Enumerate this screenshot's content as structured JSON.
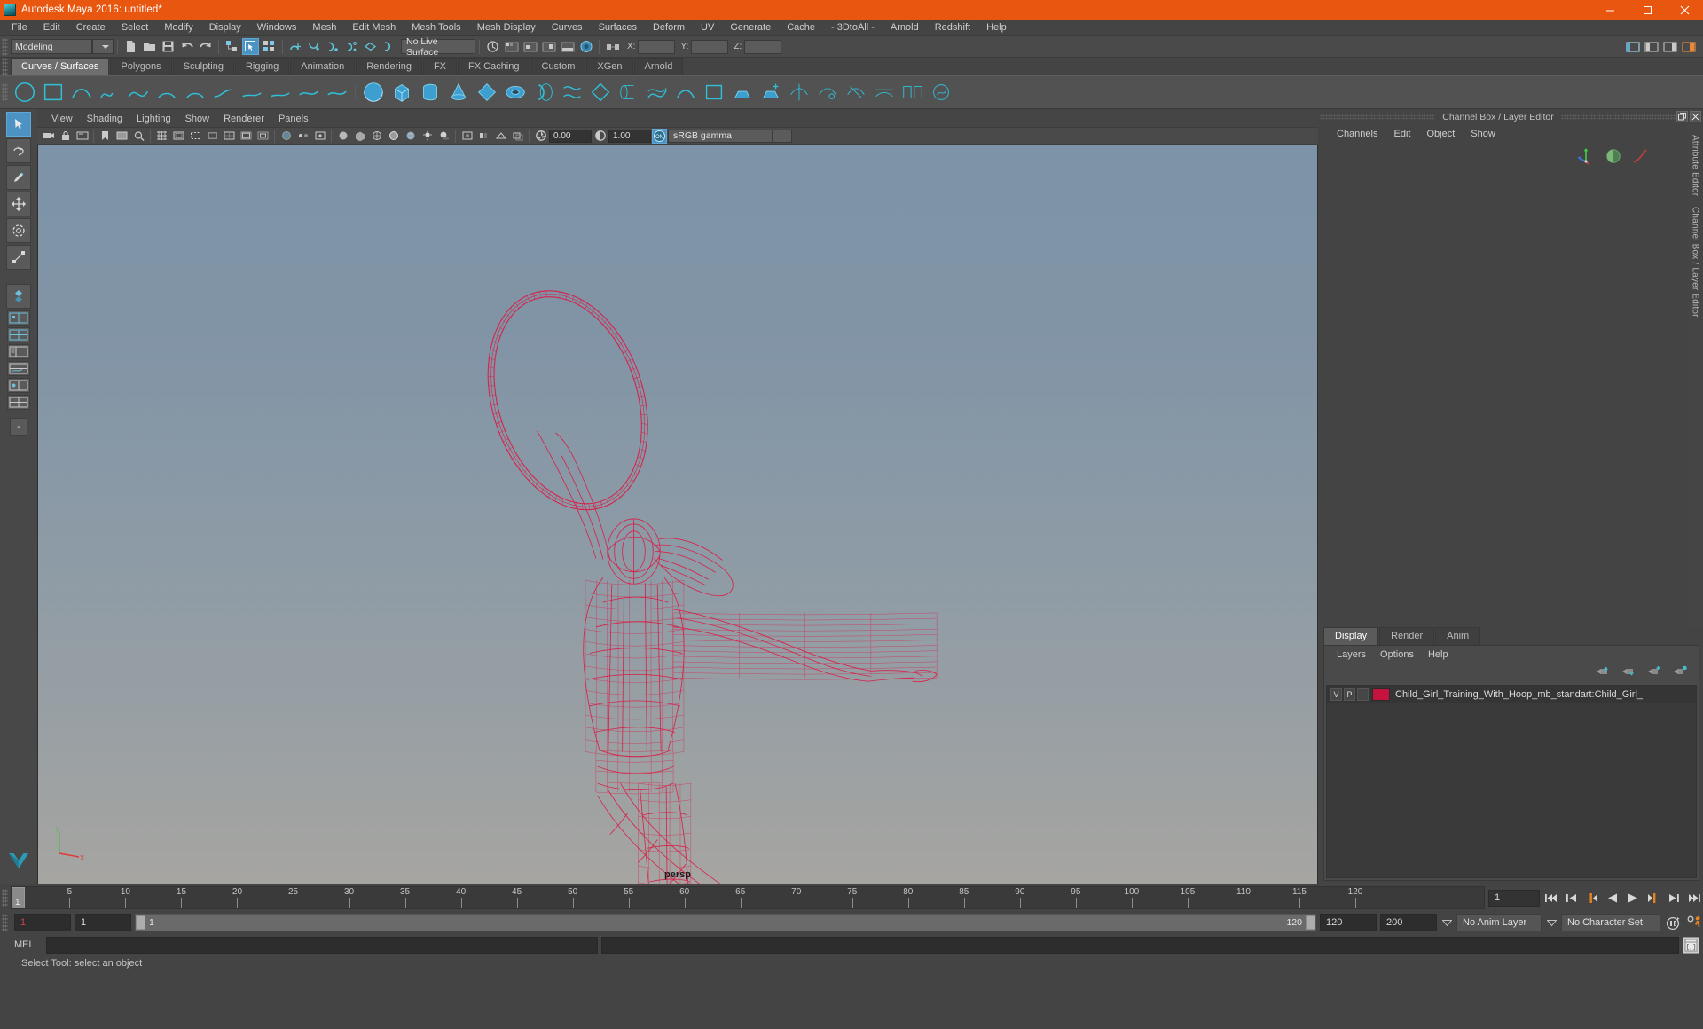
{
  "window": {
    "title": "Autodesk Maya 2016: untitled*",
    "logo_icon": "maya-logo-icon",
    "minimize_label": "–",
    "maximize_label": "❐",
    "close_label": "✕"
  },
  "menubar": {
    "items": [
      "File",
      "Edit",
      "Create",
      "Select",
      "Modify",
      "Display",
      "Windows",
      "Mesh",
      "Edit Mesh",
      "Mesh Tools",
      "Mesh Display",
      "Curves",
      "Surfaces",
      "Deform",
      "UV",
      "Generate",
      "Cache",
      "- 3DtoAll -",
      "Arnold",
      "Redshift",
      "Help"
    ]
  },
  "toolbar": {
    "menuset": "Modeling",
    "live_surface": "No Live Surface",
    "coord_labels": {
      "x": "X:",
      "y": "Y:",
      "z": "Z:"
    },
    "coord_values": {
      "x": "",
      "y": "",
      "z": ""
    },
    "icons": [
      "new-scene-icon",
      "open-scene-icon",
      "save-scene-icon",
      "undo-icon",
      "redo-icon",
      "select-hierarchy-icon",
      "select-object-icon",
      "select-component-icon",
      "snap-grid-icon",
      "snap-curve-icon",
      "snap-point-icon",
      "snap-projected-icon",
      "snap-view-plane-icon",
      "make-live-icon"
    ],
    "right_icons": [
      "show-hide-ui-icon",
      "attribute-editor-icon",
      "tool-settings-icon",
      "channel-box-icon"
    ]
  },
  "shelf": {
    "tabs": [
      "Curves / Surfaces",
      "Polygons",
      "Sculpting",
      "Rigging",
      "Animation",
      "Rendering",
      "FX",
      "FX Caching",
      "Custom",
      "XGen",
      "Arnold"
    ],
    "active_tab": "Curves / Surfaces",
    "icons": [
      "nurbs-circle-icon",
      "nurbs-square-icon",
      "ep-curve-icon",
      "pencil-curve-icon",
      "bezier-curve-icon",
      "three-point-arc-icon",
      "two-point-arc-icon",
      "curve-fillet-icon",
      "attach-curves-icon",
      "detach-curves-icon",
      "offset-curve-icon",
      "rebuild-curve-icon",
      "nurbs-sphere-icon",
      "nurbs-cube-icon",
      "nurbs-cylinder-icon",
      "nurbs-cone-icon",
      "nurbs-plane-icon",
      "nurbs-torus-icon",
      "revolve-icon",
      "loft-icon",
      "planar-icon",
      "extrude-icon",
      "birail-icon",
      "boundary-icon",
      "square-surface-icon",
      "bevel-icon",
      "bevel-plus-icon",
      "intersect-surfaces-icon",
      "trim-tool-icon",
      "untrim-icon",
      "project-curve-icon",
      "attach-surfaces-icon",
      "detach-surfaces-icon",
      "align-surfaces-icon",
      "insert-isoparm-icon",
      "offset-surface-icon",
      "sculpt-geometry-icon"
    ]
  },
  "lefttoolbox": {
    "items": [
      "select-tool-icon",
      "lasso-select-tool-icon",
      "paint-select-tool-icon",
      "move-tool-icon",
      "rotate-tool-icon",
      "scale-tool-icon",
      "last-tool-used-icon",
      "camera-layout-icon",
      "two-pane-layout-icon",
      "outliner-persp-layout-icon",
      "persp-graph-layout-icon",
      "hypershade-persp-layout-icon",
      "more-layouts-icon"
    ],
    "active": "select-tool-icon",
    "dash_label": "-"
  },
  "viewport": {
    "menus": [
      "View",
      "Shading",
      "Lighting",
      "Show",
      "Renderer",
      "Panels"
    ],
    "camera_label": "persp",
    "exposure_value": "0.00",
    "gamma_value": "1.00",
    "color_management": "sRGB gamma",
    "color_management_toggle": "ON",
    "toolbar_icons": [
      "select-camera-icon",
      "lock-camera-icon",
      "camera-attributes-icon",
      "bookmark-icon",
      "image-plane-icon",
      "two-d-pan-zoom-icon",
      "grid-toggle-icon",
      "film-gate-icon",
      "resolution-gate-icon",
      "gate-mask-icon",
      "field-chart-icon",
      "safe-action-icon",
      "safe-title-icon",
      "xray-icon",
      "xray-joints-icon",
      "xray-active-components-icon",
      "exposure-icon",
      "gamma-icon",
      "color-management-icon",
      "isolate-select-icon",
      "wireframe-icon",
      "smooth-shade-icon",
      "flat-shade-icon",
      "shaded-wireframe-icon",
      "textured-icon",
      "lights-icon",
      "shadows-icon",
      "screen-space-ao-icon",
      "motion-blur-icon",
      "multisample-icon",
      "depth-peel-icon"
    ],
    "model": {
      "name": "child-girl-with-hoop-wireframe",
      "wire_color": "#d91e47"
    },
    "axis_labels": {
      "y": "Y",
      "x": "X"
    }
  },
  "rightpanel": {
    "title": "Channel Box / Layer Editor",
    "undock_label": "❐",
    "close_label": "✕",
    "menus": [
      "Channels",
      "Edit",
      "Object",
      "Show"
    ],
    "side_tabs": [
      "Attribute Editor",
      "Channel Box / Layer Editor"
    ],
    "quick_icons": [
      "axis-manipulator-icon",
      "sphere-preview-icon",
      "curve-tangent-icon"
    ],
    "layer_editor": {
      "tabs": [
        "Display",
        "Render",
        "Anim"
      ],
      "active_tab": "Display",
      "menus": [
        "Layers",
        "Options",
        "Help"
      ],
      "toolbar_icons": [
        "move-layer-up-icon",
        "move-layer-down-icon",
        "new-layer-icon",
        "new-layer-from-selected-icon"
      ],
      "layers": [
        {
          "visibility": "V",
          "playback": "P",
          "shading": "",
          "color": "#c4133f",
          "name": "Child_Girl_Training_With_Hoop_mb_standart:Child_Girl_"
        }
      ]
    }
  },
  "timeslider": {
    "ticks": [
      5,
      10,
      15,
      20,
      25,
      30,
      35,
      40,
      45,
      50,
      55,
      60,
      65,
      70,
      75,
      80,
      85,
      90,
      95,
      100,
      105,
      110,
      115,
      120
    ],
    "start": 1,
    "end": 120,
    "current_frame": "1",
    "current_frame_field": "1",
    "playback_icons": [
      "go-to-start-icon",
      "step-back-frame-icon",
      "step-back-key-icon",
      "play-backwards-icon",
      "play-forwards-icon",
      "step-forward-key-icon",
      "step-forward-frame-icon",
      "go-to-end-icon"
    ]
  },
  "rangeslider": {
    "anim_start": "1",
    "range_start": "1",
    "bar_start": "1",
    "bar_end": "120",
    "range_end": "120",
    "anim_end": "200",
    "anim_layer": "No Anim Layer",
    "character_set": "No Character Set",
    "auto_key_icon": "auto-keyframe-icon",
    "anim_prefs_icon": "animation-preferences-icon"
  },
  "commandline": {
    "language": "MEL",
    "input_value": "",
    "output_value": "",
    "script_editor_icon": "script-editor-icon"
  },
  "statusbar": {
    "message": "Select Tool: select an object"
  }
}
